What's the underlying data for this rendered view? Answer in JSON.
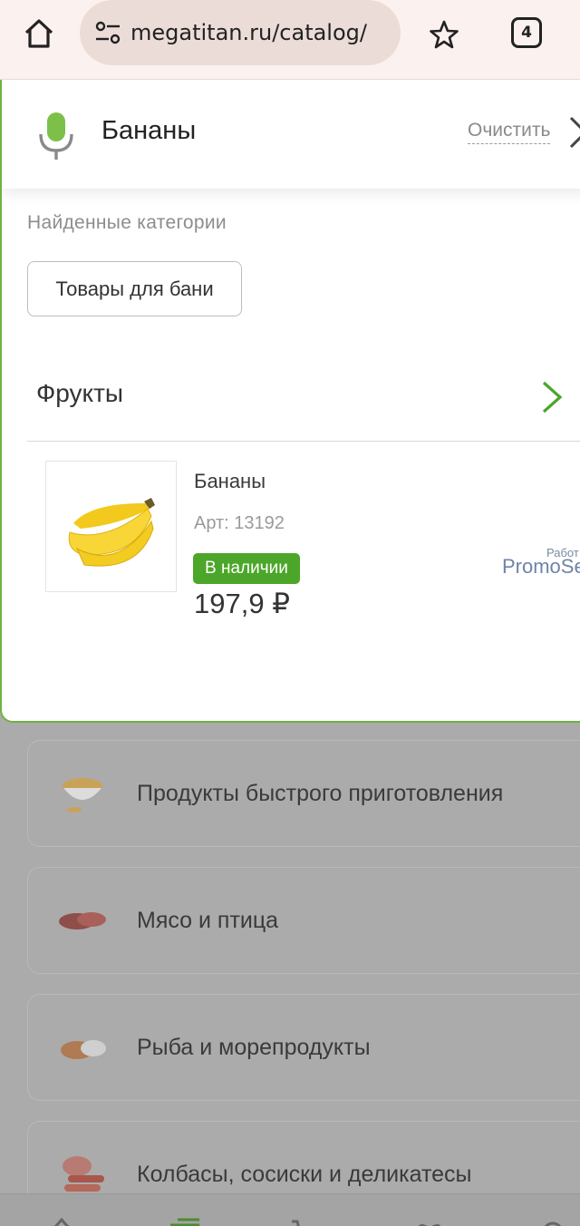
{
  "browser": {
    "url": "megatitan.ru/catalog/",
    "tab_count": "4"
  },
  "search": {
    "query": "Бананы",
    "clear_label": "Очистить",
    "found_categories_heading": "Найденные категории",
    "category_chips": [
      "Товары для бани"
    ]
  },
  "results": {
    "section_title": "Фрукты",
    "product": {
      "name": "Бананы",
      "sku": "Арт: 13192",
      "stock": "В наличии",
      "price": "197,9 ₽"
    },
    "promo_small": "Работ",
    "promo_big": "PromoSe"
  },
  "catalog": {
    "items": [
      {
        "label": "Продукты быстрого приготовления",
        "icon": "noodles-bowl-icon"
      },
      {
        "label": "Мясо и птица",
        "icon": "meat-icon"
      },
      {
        "label": "Рыба и морепродукты",
        "icon": "fish-icon"
      },
      {
        "label": "Колбасы, сосиски и деликатесы",
        "icon": "sausage-icon"
      }
    ]
  },
  "colors": {
    "accent_green": "#4ba629",
    "panel_border": "#6fb23e",
    "mic_green": "#7cc04a"
  }
}
